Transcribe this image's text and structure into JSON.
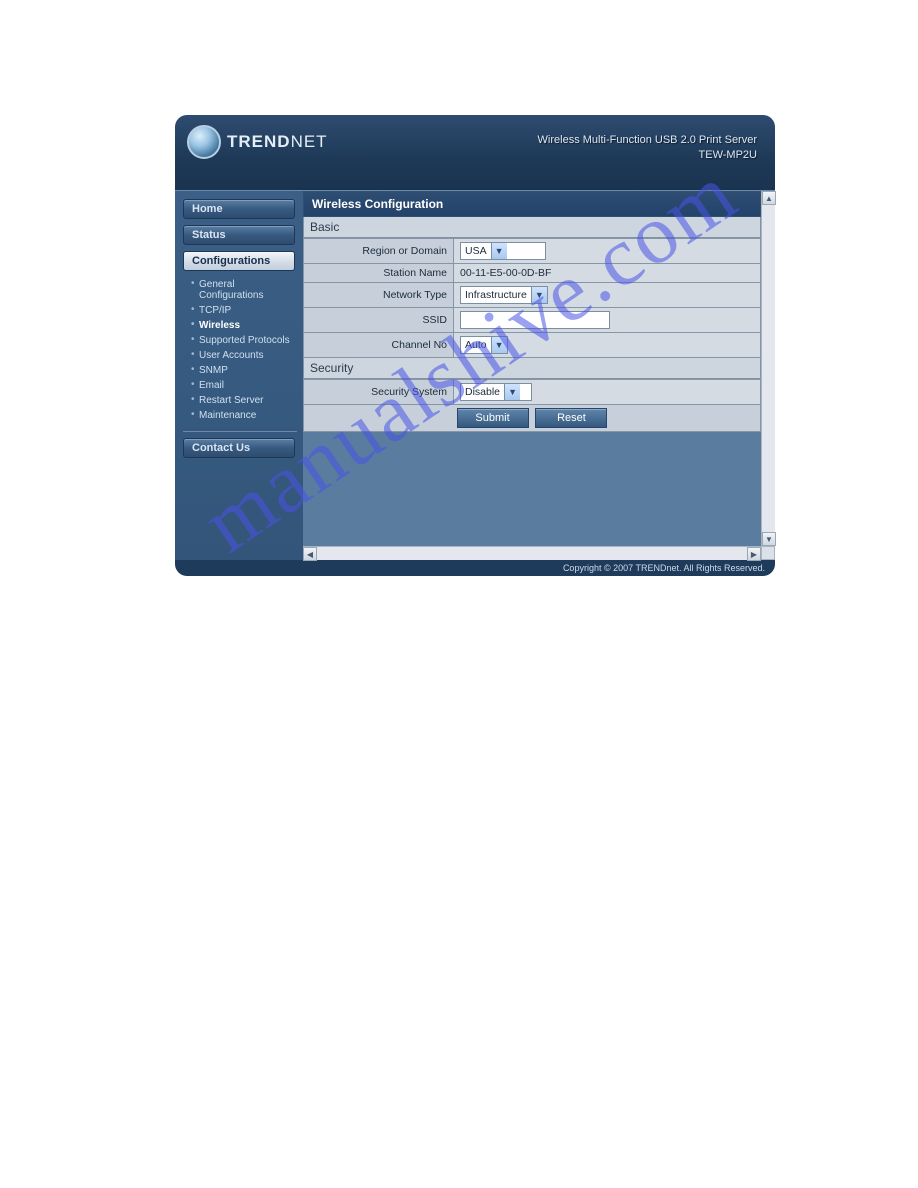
{
  "header": {
    "brand_main": "TREND",
    "brand_sub": "NET",
    "subtitle_line1": "Wireless Multi-Function USB 2.0 Print Server",
    "subtitle_line2": "TEW-MP2U"
  },
  "sidebar": {
    "items": [
      {
        "label": "Home"
      },
      {
        "label": "Status"
      },
      {
        "label": "Configurations"
      },
      {
        "label": "Contact Us"
      }
    ],
    "config_sub": [
      "General Configurations",
      "TCP/IP",
      "Wireless",
      "Supported Protocols",
      "User Accounts",
      "SNMP",
      "Email",
      "Restart Server",
      "Maintenance"
    ]
  },
  "page": {
    "title": "Wireless Configuration",
    "sections": {
      "basic": {
        "heading": "Basic",
        "region_label": "Region or Domain",
        "region_value": "USA",
        "station_label": "Station Name",
        "station_value": "00-11-E5-00-0D-BF",
        "nettype_label": "Network Type",
        "nettype_value": "Infrastructure",
        "ssid_label": "SSID",
        "ssid_value": "",
        "channel_label": "Channel No",
        "channel_value": "Auto"
      },
      "security": {
        "heading": "Security",
        "system_label": "Security System",
        "system_value": "Disable"
      }
    },
    "buttons": {
      "submit": "Submit",
      "reset": "Reset"
    }
  },
  "footer": {
    "copyright": "Copyright © 2007 TRENDnet. All Rights Reserved."
  },
  "watermark": "manualshive.com"
}
